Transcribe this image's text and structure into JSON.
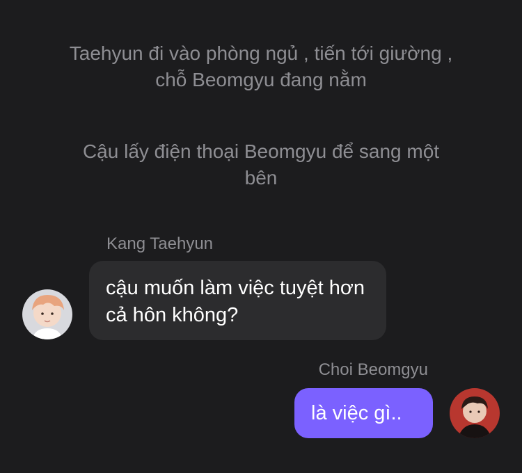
{
  "narration": [
    "Taehyun đi vào phòng ngủ , tiến tới giường , chỗ Beomgyu đang nằm",
    "Cậu lấy điện thoại Beomgyu để sang một bên"
  ],
  "messages": [
    {
      "sender": "Kang Taehyun",
      "text": "cậu muốn làm việc tuyệt hơn cả hôn không?",
      "side": "left"
    },
    {
      "sender": "Choi Beomgyu",
      "text": "là việc gì..",
      "side": "right"
    }
  ],
  "colors": {
    "background": "#1c1c1e",
    "incoming_bubble": "#2c2c2e",
    "outgoing_bubble": "#7b61ff",
    "muted_text": "#8e8e93"
  }
}
